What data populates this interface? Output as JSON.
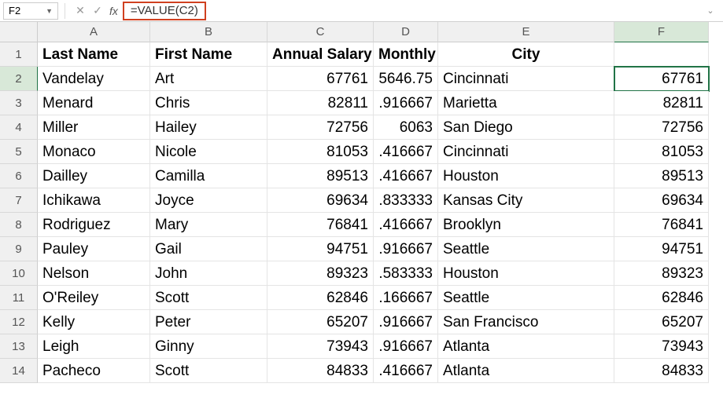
{
  "formula_bar": {
    "name_box": "F2",
    "formula": "=VALUE(C2)"
  },
  "columns": [
    "A",
    "B",
    "C",
    "D",
    "E",
    "F"
  ],
  "active_col": "F",
  "active_row": 2,
  "headers": {
    "A": "Last Name",
    "B": "First Name",
    "C": "Annual Salary",
    "D": "Monthly",
    "E": "City",
    "F": ""
  },
  "rows": [
    {
      "n": 1
    },
    {
      "n": 2,
      "A": "Vandelay",
      "B": "Art",
      "C": "67761",
      "D": "5646.75",
      "E": "Cincinnati",
      "F": "67761"
    },
    {
      "n": 3,
      "A": "Menard",
      "B": "Chris",
      "C": "82811",
      "D": ".916667",
      "E": "Marietta",
      "F": "82811"
    },
    {
      "n": 4,
      "A": "Miller",
      "B": "Hailey",
      "C": "72756",
      "D": "6063",
      "E": "San Diego",
      "F": "72756"
    },
    {
      "n": 5,
      "A": "Monaco",
      "B": "Nicole",
      "C": "81053",
      "D": ".416667",
      "E": "Cincinnati",
      "F": "81053"
    },
    {
      "n": 6,
      "A": "Dailley",
      "B": "Camilla",
      "C": "89513",
      "D": ".416667",
      "E": "Houston",
      "F": "89513"
    },
    {
      "n": 7,
      "A": "Ichikawa",
      "B": "Joyce",
      "C": "69634",
      "D": ".833333",
      "E": "Kansas City",
      "F": "69634"
    },
    {
      "n": 8,
      "A": "Rodriguez",
      "B": "Mary",
      "C": "76841",
      "D": ".416667",
      "E": "Brooklyn",
      "F": "76841"
    },
    {
      "n": 9,
      "A": "Pauley",
      "B": "Gail",
      "C": "94751",
      "D": ".916667",
      "E": "Seattle",
      "F": "94751"
    },
    {
      "n": 10,
      "A": "Nelson",
      "B": "John",
      "C": "89323",
      "D": ".583333",
      "E": "Houston",
      "F": "89323"
    },
    {
      "n": 11,
      "A": "O'Reiley",
      "B": "Scott",
      "C": "62846",
      "D": ".166667",
      "E": "Seattle",
      "F": "62846"
    },
    {
      "n": 12,
      "A": "Kelly",
      "B": "Peter",
      "C": "65207",
      "D": ".916667",
      "E": "San Francisco",
      "F": "65207"
    },
    {
      "n": 13,
      "A": "Leigh",
      "B": "Ginny",
      "C": "73943",
      "D": ".916667",
      "E": "Atlanta",
      "F": "73943"
    },
    {
      "n": 14,
      "A": "Pacheco",
      "B": "Scott",
      "C": "84833",
      "D": ".416667",
      "E": "Atlanta",
      "F": "84833"
    }
  ]
}
